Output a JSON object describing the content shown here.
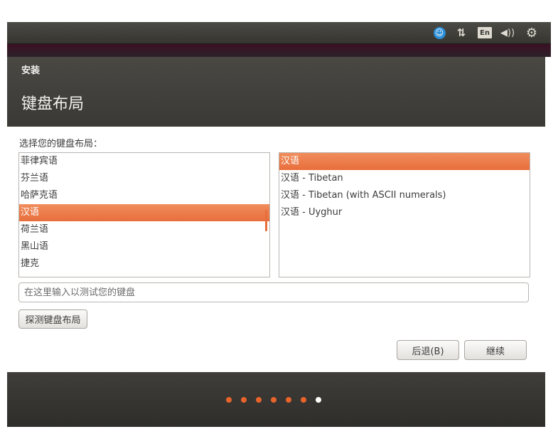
{
  "topbar": {
    "icons": [
      "accessibility-icon",
      "network-icon",
      "keyboard-language-icon",
      "volume-icon",
      "settings-icon"
    ],
    "lang_label": "En",
    "net_glyph": "⇅",
    "vol_glyph": "◀))",
    "gear_glyph": "⚙",
    "acc_glyph": "☺"
  },
  "window": {
    "title": "安装",
    "page_title": "键盘布局",
    "prompt": "选择您的键盘布局："
  },
  "layouts": {
    "items": [
      "菲律宾语",
      "芬兰语",
      "哈萨克语",
      "汉语",
      "荷兰语",
      "黑山语",
      "捷克"
    ],
    "selected_index": 3
  },
  "variants": {
    "items": [
      "汉语",
      "汉语 - Tibetan",
      "汉语 - Tibetan (with ASCII numerals)",
      "汉语 - Uyghur"
    ],
    "selected_index": 0
  },
  "test_input": {
    "placeholder": "在这里输入以测试您的键盘",
    "value": ""
  },
  "buttons": {
    "detect": "探测键盘布局",
    "back": "后退(B)",
    "continue": "继续"
  },
  "progress": {
    "total_steps": 7,
    "current_step": 7,
    "done_color": "#e8642a",
    "current_color": "#ffffff"
  },
  "colors": {
    "accent": "#e86e3c",
    "panel": "#3c3b37"
  }
}
